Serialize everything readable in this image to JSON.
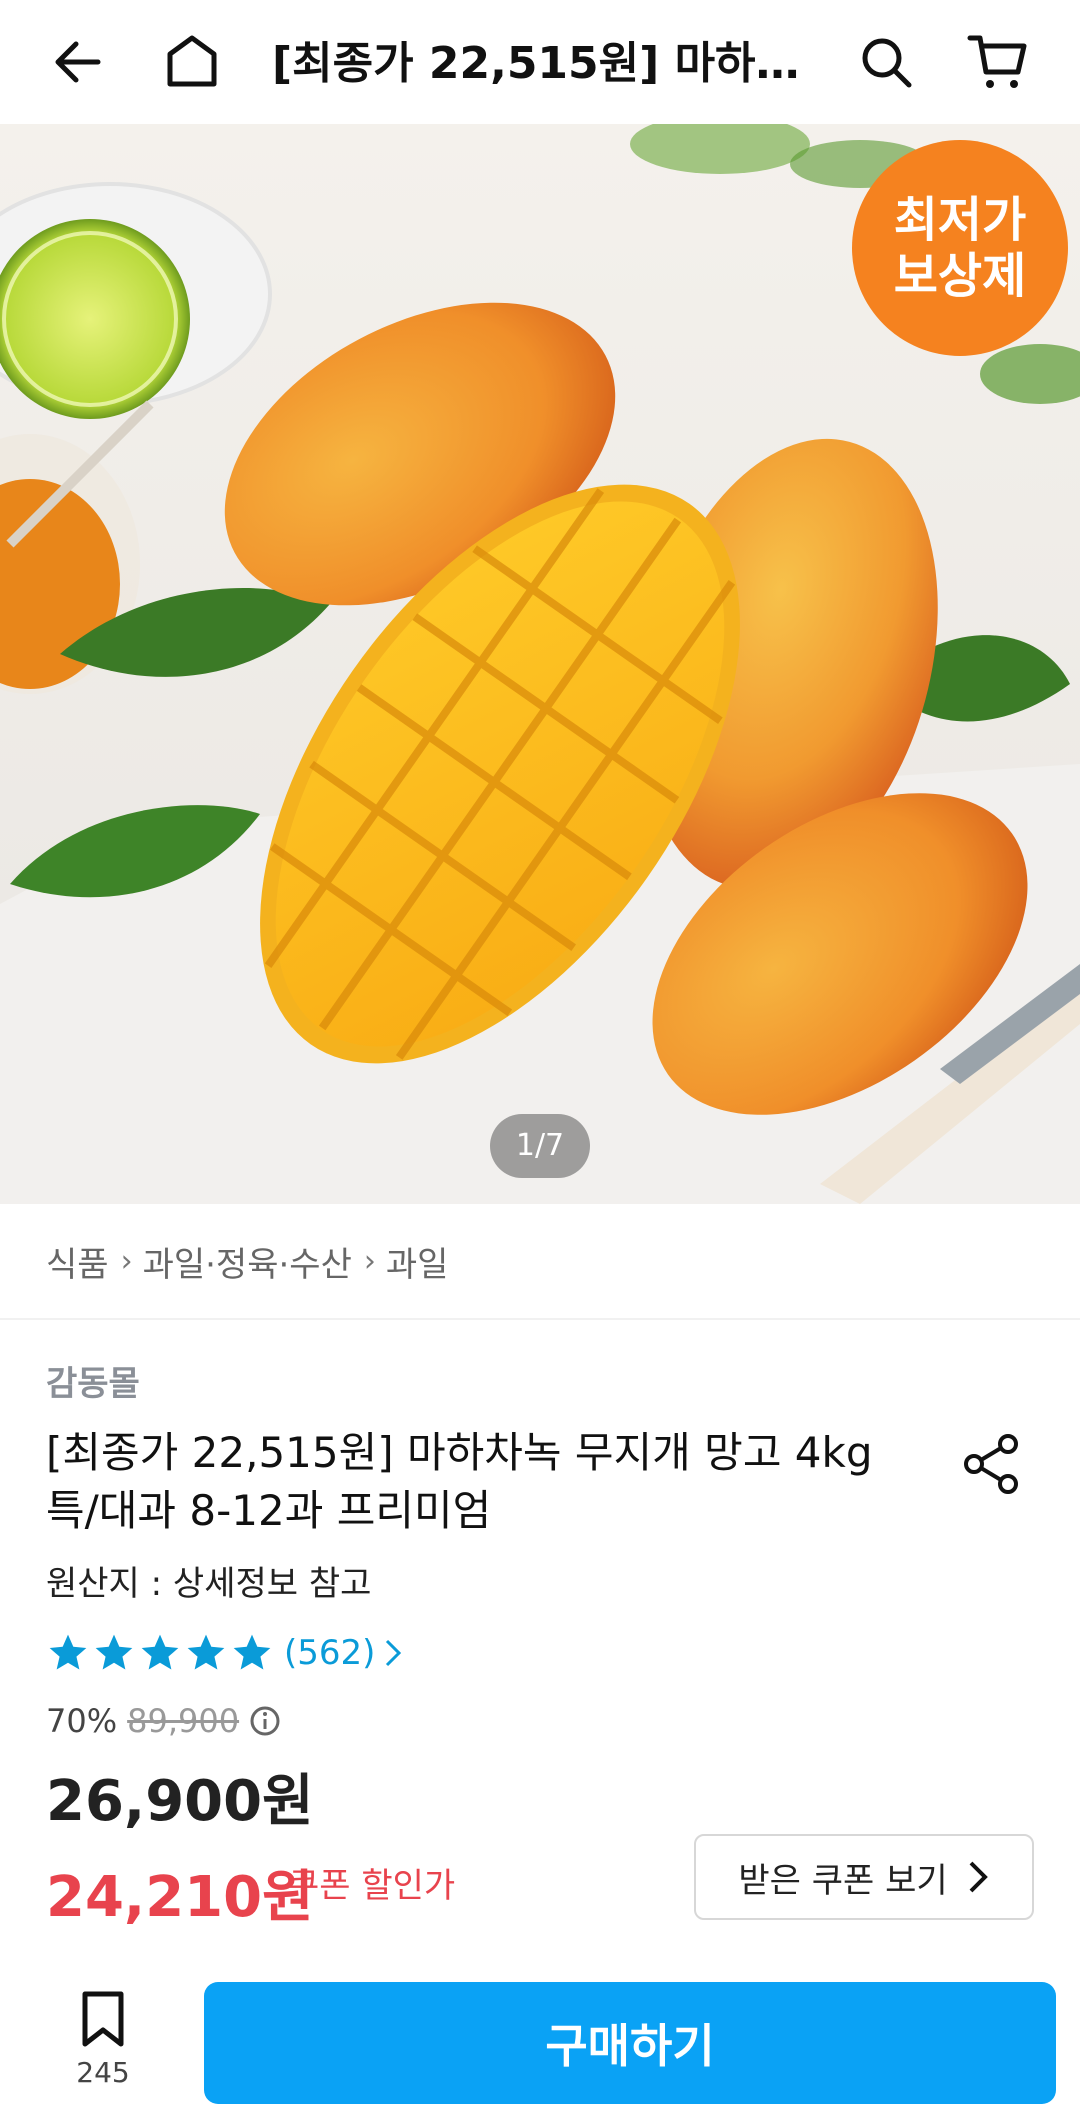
{
  "header": {
    "title": "[최종가 22,515원] 마하차…",
    "back_icon": "arrow-left-icon",
    "home_icon": "home-icon",
    "search_icon": "search-icon",
    "cart_icon": "cart-icon"
  },
  "hero": {
    "badge_line1": "최저가",
    "badge_line2": "보상제",
    "badge_color": "#f5821f",
    "counter": "1/7"
  },
  "breadcrumb": [
    "식품",
    "과일·정육·수산",
    "과일"
  ],
  "product": {
    "seller": "감동몰",
    "title": "[최종가 22,515원] 마하차녹 무지개 망고 4kg 특/대과 8-12과 프리미엄",
    "origin": "원산지 : 상세정보 참고",
    "rating": 5,
    "review_count": "(562)",
    "discount": "70%",
    "original_price": "89,900",
    "price": "26,900원",
    "coupon_price": "24,210원",
    "coupon_label": "쿠폰 할인가",
    "coupon_button": "받은 쿠폰 보기"
  },
  "bottom": {
    "bookmark_count": "245",
    "buy_label": "구매하기",
    "buy_color": "#0aa2f5"
  }
}
